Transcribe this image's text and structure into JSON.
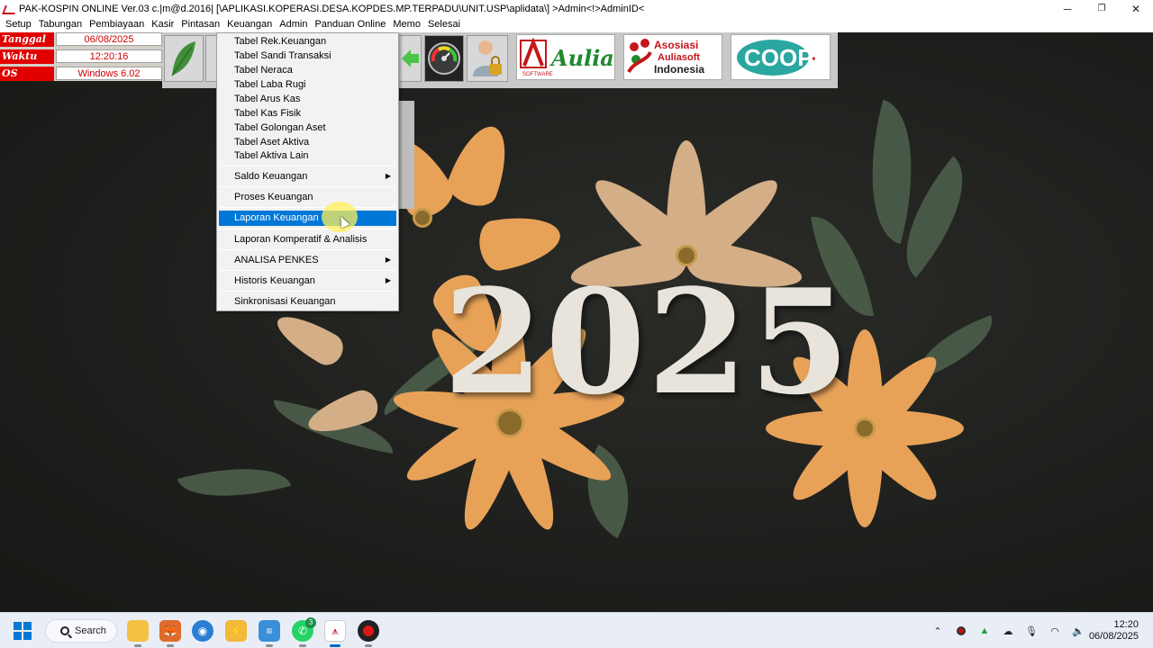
{
  "window": {
    "title": "PAK-KOSPIN ONLINE Ver.03 c.|m@d.2016| [\\APLIKASI.KOPERASI.DESA.KOPDES.MP.TERPADU\\UNIT.USP\\aplidata\\] >Admin<!>AdminID<",
    "minimize": "─",
    "maximize": "❐",
    "close": "✕"
  },
  "menubar": {
    "items": [
      "Setup",
      "Tabungan",
      "Pembiayaan",
      "Kasir",
      "Pintasan",
      "Keuangan",
      "Admin",
      "Panduan Online",
      "Memo",
      "Selesai"
    ]
  },
  "info_panel": {
    "tanggal_label": "Tanggal",
    "tanggal_value": "06/08/2025",
    "waktu_label": "Waktu",
    "waktu_value": "12:20:16",
    "os_label": "OS",
    "os_value": "Windows 6.02"
  },
  "logos": {
    "aulia": "Aulia",
    "aulia_sub": "SOFTWARE",
    "asosiasi_line1": "Asosiasi",
    "asosiasi_line2": "Auliasoft",
    "asosiasi_line3": "Indonesia",
    "coop": "COOP"
  },
  "dropdown": {
    "items": [
      "Tabel Rek.Keuangan",
      "Tabel Sandi Transaksi",
      "Tabel Neraca",
      "Tabel Laba Rugi",
      "Tabel Arus Kas",
      "Tabel Kas Fisik",
      "Tabel Golongan Aset",
      "Tabel Aset Aktiva",
      "Tabel Aktiva Lain"
    ],
    "saldo": "Saldo Keuangan",
    "proses": "Proses Keuangan",
    "laporan": "Laporan Keuangan",
    "komperatif": "Laporan Komperatif & Analisis",
    "analisa": "ANALISA PENKES",
    "historis": "Historis Keuangan",
    "sinkronisasi": "Sinkronisasi Keuangan",
    "submenu_arrow": "▶"
  },
  "background": {
    "year": "2025"
  },
  "taskbar": {
    "search_label": "Search",
    "whatsapp_badge": "3",
    "time": "12:20",
    "date": "06/08/2025"
  },
  "colors": {
    "highlight": "#0078d7",
    "info_label_bg": "#e00000",
    "info_value_text": "#d00000",
    "petal_orange": "#e7a258",
    "leaf_green": "#4d5e4a"
  }
}
